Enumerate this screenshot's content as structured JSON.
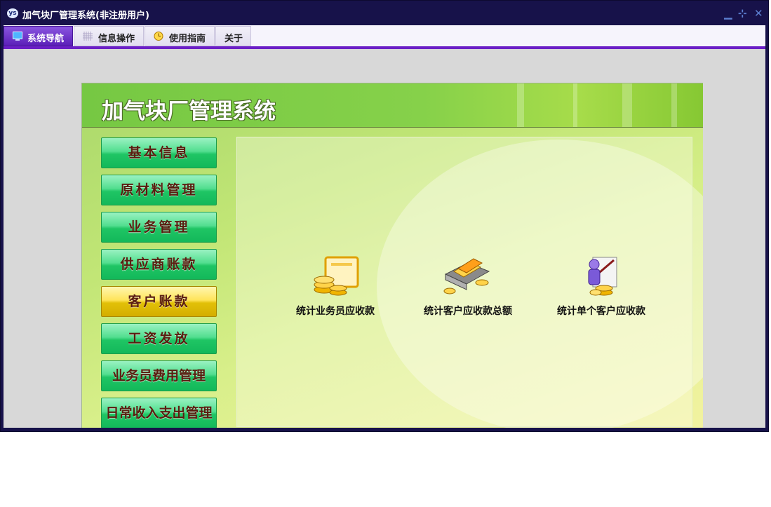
{
  "window": {
    "title": "加气块厂管理系统(非注册用户)",
    "logo_text": "ys",
    "controls": {
      "minimize": "▁",
      "restore": "⊹",
      "close": "✕"
    }
  },
  "tabs": [
    {
      "label": "系统导航",
      "icon": "monitor-icon",
      "active": true
    },
    {
      "label": "信息操作",
      "icon": "grid-icon",
      "active": false
    },
    {
      "label": "使用指南",
      "icon": "clock-icon",
      "active": false
    },
    {
      "label": "关于",
      "icon": "",
      "active": false
    }
  ],
  "app": {
    "title": "加气块厂管理系统"
  },
  "nav": {
    "items": [
      {
        "label": "基本信息",
        "selected": false
      },
      {
        "label": "原材料管理",
        "selected": false
      },
      {
        "label": "业务管理",
        "selected": false
      },
      {
        "label": "供应商账款",
        "selected": false
      },
      {
        "label": "客户账款",
        "selected": true
      },
      {
        "label": "工资发放",
        "selected": false
      },
      {
        "label": "业务员费用管理",
        "selected": false
      },
      {
        "label": "日常收入支出管理",
        "selected": false
      }
    ]
  },
  "functions": [
    {
      "label": "统计业务员应收款",
      "icon": "coins-card-icon"
    },
    {
      "label": "统计客户应收款总额",
      "icon": "money-stack-icon"
    },
    {
      "label": "统计单个客户应收款",
      "icon": "person-coins-icon"
    }
  ],
  "colors": {
    "titlebar": "#17124a",
    "tab_active": "#5b1fb8",
    "nav_green": "#1fc564",
    "nav_selected": "#e2c008",
    "nav_text": "#5a1d10"
  }
}
